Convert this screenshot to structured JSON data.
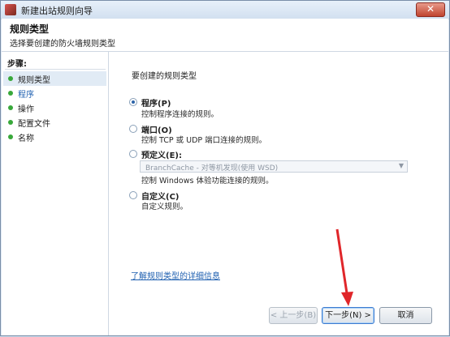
{
  "window": {
    "title": "新建出站规则向导",
    "close_glyph": "✕"
  },
  "header": {
    "title": "规则类型",
    "subtitle": "选择要创建的防火墙规则类型"
  },
  "sidebar": {
    "steps_title": "步骤:",
    "steps": [
      {
        "label": "规则类型",
        "state": "selected"
      },
      {
        "label": "程序",
        "state": "link"
      },
      {
        "label": "操作",
        "state": "normal"
      },
      {
        "label": "配置文件",
        "state": "normal"
      },
      {
        "label": "名称",
        "state": "normal"
      }
    ]
  },
  "main": {
    "prompt": "要创建的规则类型",
    "options": [
      {
        "label": "程序(P)",
        "desc": "控制程序连接的规则。",
        "checked": true
      },
      {
        "label": "端口(O)",
        "desc": "控制 TCP 或 UDP 端口连接的规则。",
        "checked": false
      },
      {
        "label": "预定义(E):",
        "desc": "控制 Windows 体验功能连接的规则。",
        "checked": false
      },
      {
        "label": "自定义(C)",
        "desc": "自定义规则。",
        "checked": false
      }
    ],
    "predefined_dropdown": {
      "value": "BranchCache - 对等机发现(使用 WSD)",
      "arrow": "▼"
    },
    "help_link": "了解规则类型的详细信息"
  },
  "footer": {
    "back": "< 上一步(B)",
    "next": "下一步(N) >",
    "cancel": "取消"
  },
  "colors": {
    "link": "#1e5fb0",
    "step_bullet": "#38a83a",
    "annotation_arrow": "#e0262a"
  }
}
